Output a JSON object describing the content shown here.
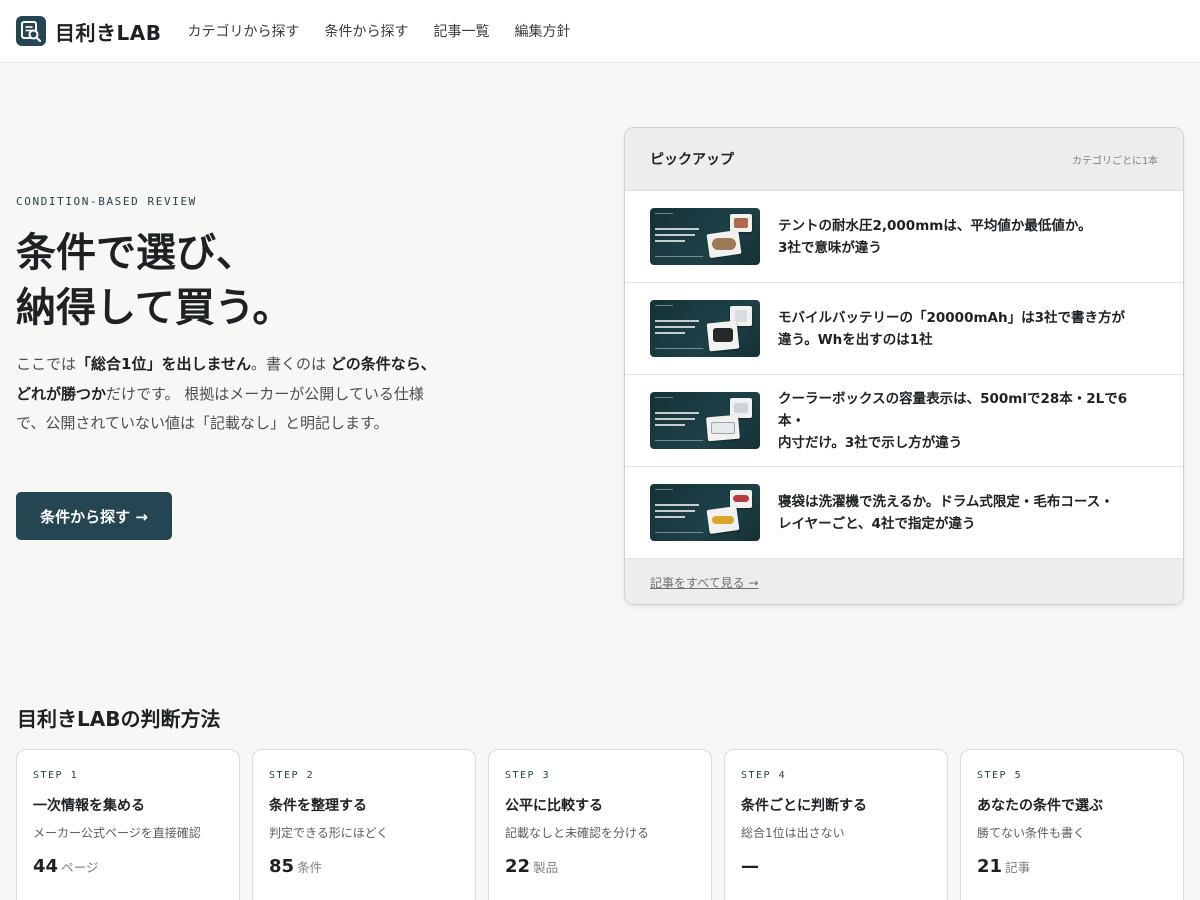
{
  "header": {
    "logo_text": "目利きLAB",
    "nav": [
      "カテゴリから探す",
      "条件から探す",
      "記事一覧",
      "編集方針"
    ]
  },
  "hero": {
    "eyebrow": "CONDITION-BASED REVIEW",
    "title_line1": "条件で選び、",
    "title_line2": "納得して買う。",
    "lead": [
      {
        "t": "ここでは",
        "b": false
      },
      {
        "t": "「総合1位」を出しません",
        "b": true
      },
      {
        "t": "。書くのは ",
        "b": false
      },
      {
        "t": "どの条件なら、どれが勝つか",
        "b": true
      },
      {
        "t": "だけです。 根拠はメーカーが公開している仕様で、公開されていない値は「記載なし」と明記します。",
        "b": false
      }
    ],
    "cta_label": "条件から探す →"
  },
  "pickup": {
    "title": "ピックアップ",
    "note": "カテゴリごとに1本",
    "items": [
      {
        "line1": "テントの耐水圧2,000mmは、平均値か最低値か。",
        "line2": "3社で意味が違う"
      },
      {
        "line1": "モバイルバッテリーの「20000mAh」は3社で書き方が",
        "line2": "違う。Whを出すのは1社"
      },
      {
        "line1": "クーラーボックスの容量表示は、500mlで28本・2Lで6本・",
        "line2": "内寸だけ。3社で示し方が違う"
      },
      {
        "line1": "寝袋は洗濯機で洗えるか。ドラム式限定・毛布コース・",
        "line2": "レイヤーごと、4社で指定が違う"
      }
    ],
    "footer_link": "記事をすべて見る →"
  },
  "method": {
    "title": "目利きLABの判断方法",
    "steps": [
      {
        "label": "STEP 1",
        "title": "一次情報を集める",
        "desc": "メーカー公式ページを直接確認",
        "num": "44",
        "unit": "ページ"
      },
      {
        "label": "STEP 2",
        "title": "条件を整理する",
        "desc": "判定できる形にほどく",
        "num": "85",
        "unit": "条件"
      },
      {
        "label": "STEP 3",
        "title": "公平に比較する",
        "desc": "記載なしと未確認を分ける",
        "num": "22",
        "unit": "製品"
      },
      {
        "label": "STEP 4",
        "title": "条件ごとに判断する",
        "desc": "総合1位は出さない",
        "num": "—",
        "unit": ""
      },
      {
        "label": "STEP 5",
        "title": "あなたの条件で選ぶ",
        "desc": "勝てない条件も書く",
        "num": "21",
        "unit": "記事"
      }
    ]
  },
  "colors": {
    "brand": "#234652",
    "background": "#f7f7f6"
  },
  "icons": {
    "logo": "magnifier-document-icon"
  }
}
